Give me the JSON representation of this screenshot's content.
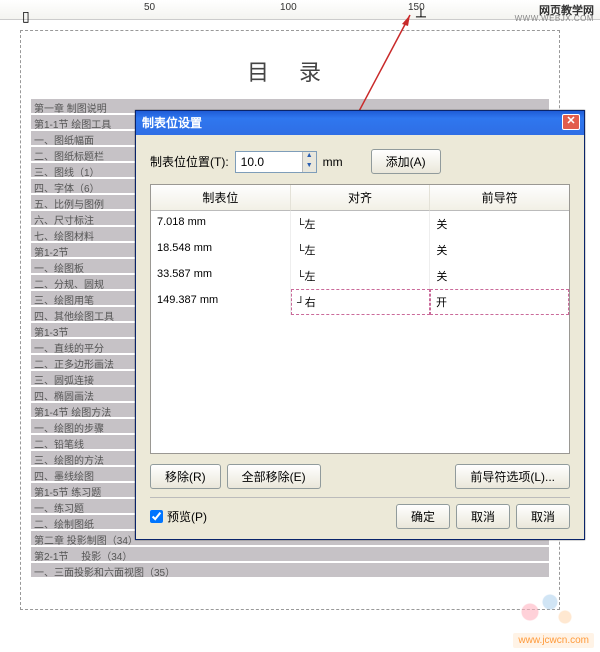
{
  "ruler": {
    "marks": [
      "50",
      "100",
      "150"
    ],
    "tabstop_glyph": "┴"
  },
  "site": {
    "name": "网页教学网",
    "sub": "WWW.WEBJX.COM"
  },
  "doc": {
    "title": "目 录",
    "toc": [
      "第一章 制图说明",
      "第1-1节 绘图工具",
      "一、图纸幅面",
      "二、图纸标题栏",
      "三、图线（1）",
      "四、字体（6）",
      "五、比例与图例",
      "六、尺寸标注",
      "七、绘图材料",
      "第1-2节",
      "一、绘图板",
      "二、分规、圆规",
      "三、绘图用笔",
      "四、其他绘图工具",
      "第1-3节",
      "一、直线的平分",
      "二、正多边形画法",
      "三、圆弧连接",
      "四、椭圆画法",
      "第1-4节 绘图方法",
      "一、绘图的步骤",
      "二、铅笔线",
      "三、绘图的方法",
      "四、墨线绘图",
      "第1-5节 练习题",
      "一、练习题",
      "二、绘制图纸",
      "第二章 投影制图（34）",
      "第2-1节　  投影（34）",
      "一、三面投影和六面视图（35）"
    ]
  },
  "dialog": {
    "title": "制表位设置",
    "pos_label": "制表位位置(T):",
    "pos_value": "10.0",
    "unit": "mm",
    "add_btn": "添加(A)",
    "col_tab": "制表位",
    "col_align": "对齐",
    "col_leader": "前导符",
    "rows": [
      {
        "v": "7.018 mm",
        "a": "└左",
        "l": "关"
      },
      {
        "v": "18.548 mm",
        "a": "└左",
        "l": "关"
      },
      {
        "v": "33.587 mm",
        "a": "└左",
        "l": "关"
      },
      {
        "v": "149.387 mm",
        "a": "┘右",
        "l": "开"
      }
    ],
    "remove": "移除(R)",
    "remove_all": "全部移除(E)",
    "leader_opts": "前导符选项(L)...",
    "preview": "预览(P)",
    "ok": "确定",
    "cancel": "取消",
    "cancel2": "取消"
  },
  "wm": "www.jcwcn.com"
}
